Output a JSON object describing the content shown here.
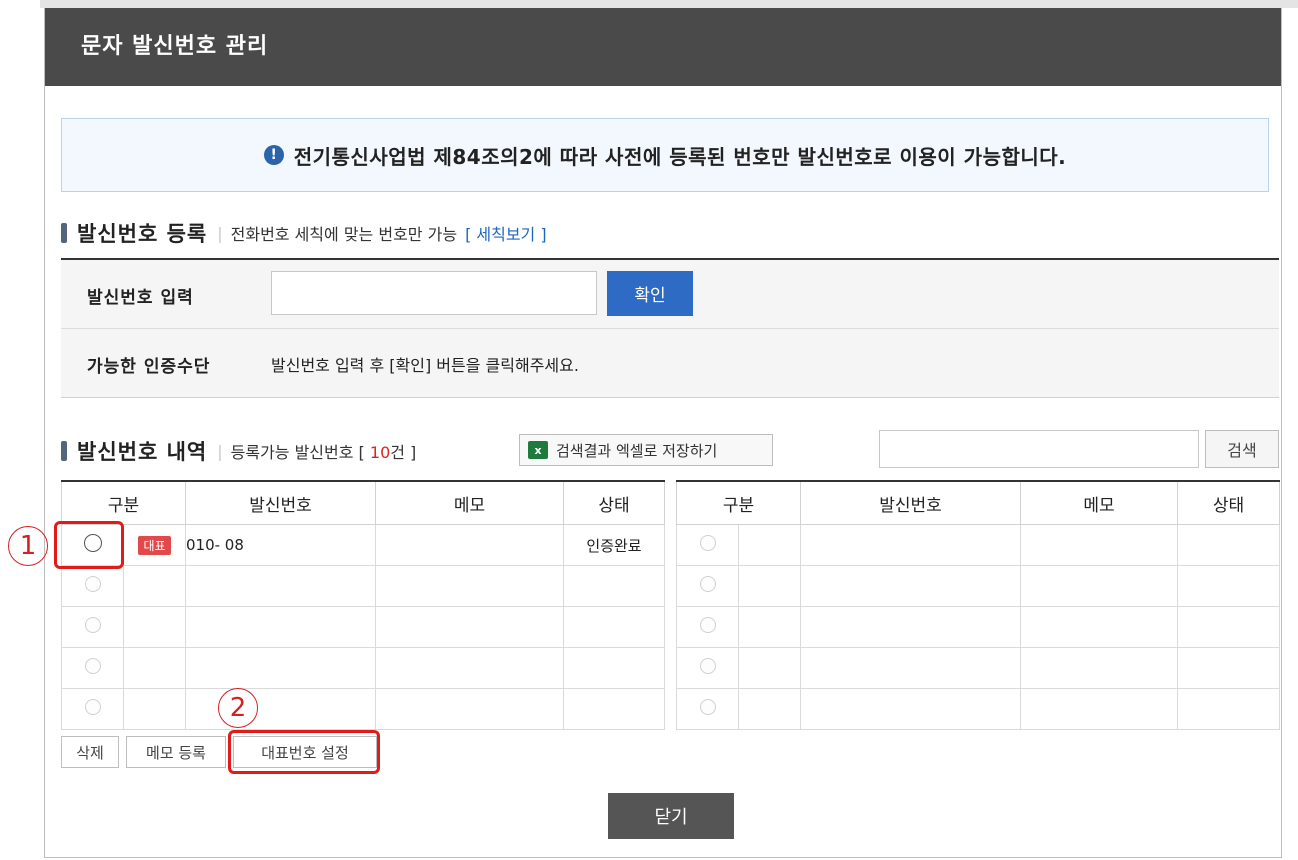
{
  "window": {
    "title": "문자 발신번호 관리"
  },
  "notice": {
    "icon": "info-icon",
    "text": "전기통신사업법 제84조의2에 따라 사전에 등록된 번호만 발신번호로 이용이 가능합니다."
  },
  "register": {
    "title": "발신번호 등록",
    "subtitle": "전화번호 세칙에 맞는 번호만 가능",
    "rules_link": "[ 세칙보기 ]",
    "input_label": "발신번호 입력",
    "input_value": "",
    "confirm_label": "확인",
    "auth_label": "가능한 인증수단",
    "auth_desc": "발신번호 입력 후 [확인] 버튼을 클릭해주세요."
  },
  "history": {
    "title": "발신번호 내역",
    "count_prefix": "등록가능 발신번호 [ ",
    "count": "10",
    "count_suffix": "건 ]",
    "excel_label": "검색결과 엑셀로 저장하기",
    "search_value": "",
    "search_label": "검색"
  },
  "table": {
    "headers": [
      "구분",
      "발신번호",
      "메모",
      "상태"
    ],
    "rep_badge": "대표",
    "left_rows": [
      {
        "number": "010-          08",
        "memo": "",
        "status": "인증완료",
        "representative": true,
        "selected": true
      }
    ]
  },
  "actions": {
    "delete_label": "삭제",
    "memo_label": "메모 등록",
    "set_rep_label": "대표번호 설정",
    "close_label": "닫기"
  },
  "callouts": {
    "one": "1",
    "two": "2"
  },
  "colors": {
    "titlebar": "#4a4a4a",
    "accent_blue": "#2d6bc5",
    "badge_red": "#e2494a",
    "callout_red": "#e11a1a"
  }
}
